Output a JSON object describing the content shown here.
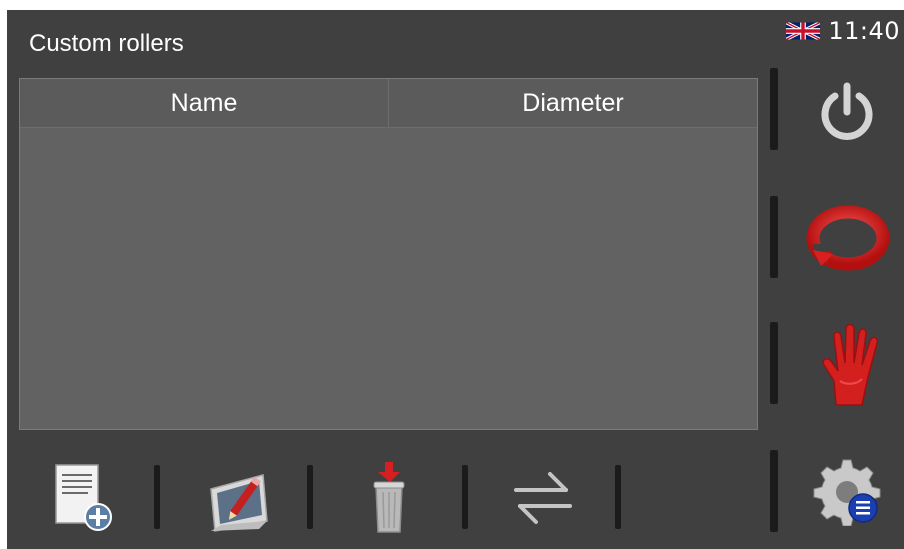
{
  "screen": {
    "title": "Custom rollers"
  },
  "status": {
    "language": "English (UK)",
    "language_icon": "uk-flag-icon",
    "time": "11:40"
  },
  "table": {
    "columns": [
      "Name",
      "Diameter"
    ],
    "rows": []
  },
  "side_buttons": [
    {
      "name": "power-button",
      "icon": "power-icon"
    },
    {
      "name": "reset-button",
      "icon": "reset-arrow-icon"
    },
    {
      "name": "stop-button",
      "icon": "red-hand-icon"
    },
    {
      "name": "settings-button",
      "icon": "gear-list-icon"
    }
  ],
  "bottom_buttons": [
    {
      "name": "add-roller-button",
      "icon": "document-add-icon"
    },
    {
      "name": "edit-roller-button",
      "icon": "pencil-edit-icon"
    },
    {
      "name": "delete-roller-button",
      "icon": "trash-icon"
    },
    {
      "name": "swap-button",
      "icon": "swap-arrows-icon"
    }
  ],
  "colors": {
    "background": "#404040",
    "table": "#626262",
    "accent_red": "#d21c1c"
  }
}
